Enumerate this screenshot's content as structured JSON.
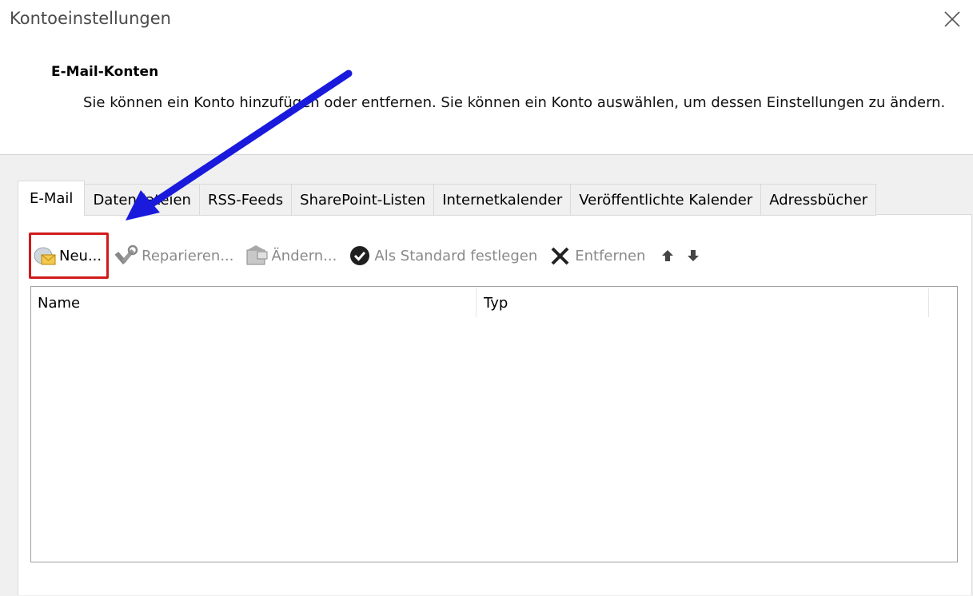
{
  "window": {
    "title": "Kontoeinstellungen",
    "close_icon": "close-icon"
  },
  "section": {
    "heading": "E-Mail-Konten",
    "description": "Sie können ein Konto hinzufügen oder entfernen. Sie können ein Konto auswählen, um dessen Einstellungen zu ändern."
  },
  "tabs": [
    {
      "label": "E-Mail",
      "active": true
    },
    {
      "label": "Datendateien"
    },
    {
      "label": "RSS-Feeds"
    },
    {
      "label": "SharePoint-Listen"
    },
    {
      "label": "Internetkalender"
    },
    {
      "label": "Veröffentlichte Kalender"
    },
    {
      "label": "Adressbücher"
    }
  ],
  "toolbar": {
    "new_label": "Neu...",
    "repair_label": "Reparieren...",
    "change_label": "Ändern...",
    "default_label": "Als Standard festlegen",
    "remove_label": "Entfernen",
    "move_up_icon": "arrow-up-icon",
    "move_down_icon": "arrow-down-icon"
  },
  "list": {
    "columns": [
      "Name",
      "Typ"
    ],
    "rows": []
  },
  "colors": {
    "highlight_box": "#d11a1a",
    "annotation_arrow": "#1a1adc",
    "panel_bg": "#f0f0f0"
  }
}
